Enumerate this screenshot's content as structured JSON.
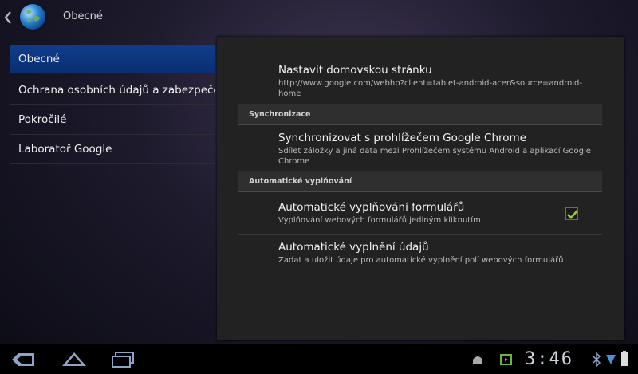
{
  "actionbar": {
    "title": "Obecné",
    "back_icon": "chevron-left-icon",
    "app_icon": "globe-icon"
  },
  "nav": {
    "items": [
      {
        "label": "Obecné",
        "active": true
      },
      {
        "label": "Ochrana osobních údajů a zabezpečení",
        "active": false
      },
      {
        "label": "Pokročilé",
        "active": false
      },
      {
        "label": "Laboratoř Google",
        "active": false
      }
    ]
  },
  "prefs": {
    "homepage": {
      "title": "Nastavit domovskou stránku",
      "summary": "http://www.google.com/webhp?client=tablet-android-acer&source=android-home"
    },
    "sync_category": "Synchronizace",
    "sync": {
      "title": "Synchronizovat s prohlížečem Google Chrome",
      "summary": "Sdílet záložky a jiná data mezi Prohlížečem systému Android a aplikací Google Chrome"
    },
    "autofill_category": "Automatické vyplňování",
    "autofill_forms": {
      "title": "Automatické vyplňování formulářů",
      "summary": "Vyplňování webových formulářů jediným kliknutím",
      "checked": true
    },
    "autofill_data": {
      "title": "Automatické vyplnění údajů",
      "summary": "Zadat a uložit údaje pro automatické vyplnění polí webových formulářů"
    }
  },
  "sysbar": {
    "time": "3:46",
    "colors": {
      "accent": "#0a2f72",
      "check": "#9acd32"
    }
  }
}
